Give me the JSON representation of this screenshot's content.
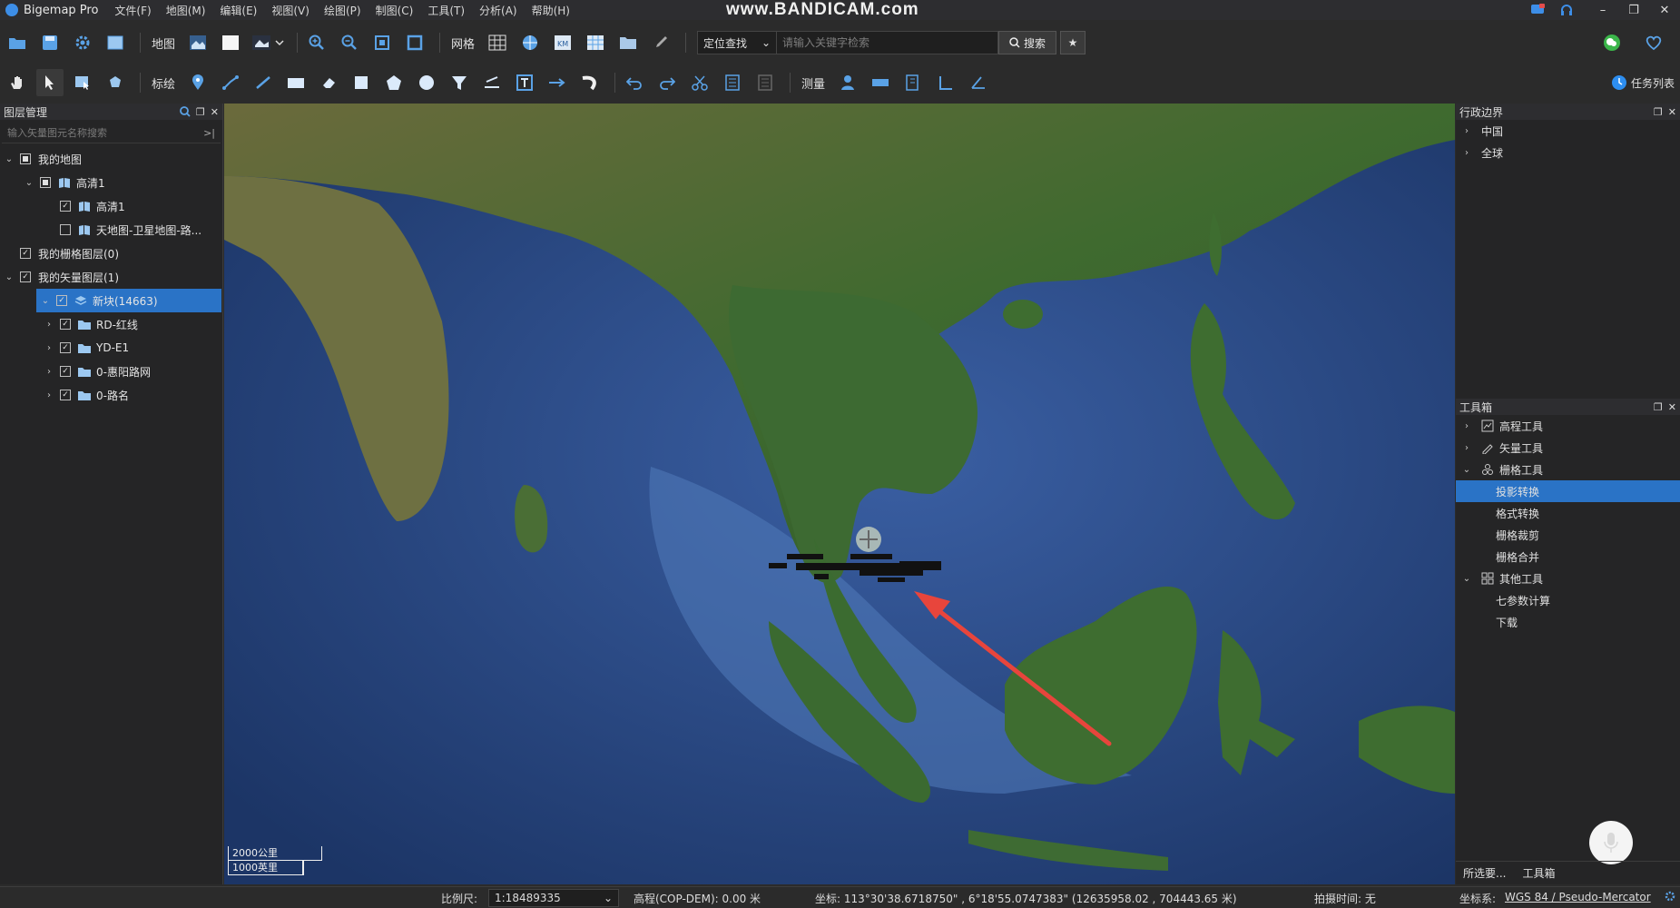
{
  "app": {
    "title": "Bigemap Pro",
    "watermark": "www.BANDICAM.com",
    "menu": [
      "文件(F)",
      "地图(M)",
      "编辑(E)",
      "视图(V)",
      "绘图(P)",
      "制图(C)",
      "工具(T)",
      "分析(A)",
      "帮助(H)"
    ]
  },
  "toolbar1": {
    "map_label": "地图",
    "grid_label": "网格",
    "locate_label": "定位查找",
    "search_placeholder": "请输入关键字检索",
    "search_button": "搜索"
  },
  "toolbar2": {
    "draw_label": "标绘",
    "measure_label": "测量",
    "task_list": "任务列表"
  },
  "layer_panel": {
    "title": "图层管理",
    "search_placeholder": "输入矢量图元名称搜索",
    "tree": [
      {
        "label": "我的地图",
        "level": 0,
        "expanded": true,
        "check": "partial"
      },
      {
        "label": "高清1",
        "level": 1,
        "expanded": true,
        "check": "partial"
      },
      {
        "label": "高清1",
        "level": 2,
        "check": "checked"
      },
      {
        "label": "天地图-卫星地图-路...",
        "level": 2,
        "check": "unchecked"
      },
      {
        "label": "我的栅格图层(0)",
        "level": 0,
        "check": "checked"
      },
      {
        "label": "我的矢量图层(1)",
        "level": 0,
        "expanded": true,
        "check": "checked"
      },
      {
        "label": "新块(14663)",
        "level": 1,
        "expanded": true,
        "check": "checked",
        "selected": true
      },
      {
        "label": "RD-红线",
        "level": 2,
        "expanded": false,
        "check": "checked"
      },
      {
        "label": "YD-E1",
        "level": 2,
        "expanded": false,
        "check": "checked"
      },
      {
        "label": "0-惠阳路网",
        "level": 2,
        "expanded": false,
        "check": "checked"
      },
      {
        "label": "0-路名",
        "level": 2,
        "expanded": false,
        "check": "checked"
      }
    ]
  },
  "map": {
    "scale_km": "2000公里",
    "scale_mi": "1000英里",
    "colors": {
      "ocean": "#2d4f8c",
      "land": "#3f6b34",
      "arrow": "#e8453c"
    }
  },
  "admin_panel": {
    "title": "行政边界",
    "items": [
      "中国",
      "全球"
    ]
  },
  "toolbox": {
    "title": "工具箱",
    "groups": [
      {
        "label": "高程工具",
        "icon": "elevation-icon",
        "expanded": false,
        "items": []
      },
      {
        "label": "矢量工具",
        "icon": "pen-icon",
        "expanded": false,
        "items": []
      },
      {
        "label": "栅格工具",
        "icon": "raster-icon",
        "expanded": true,
        "items": [
          "投影转换",
          "格式转换",
          "栅格裁剪",
          "栅格合并"
        ]
      },
      {
        "label": "其他工具",
        "icon": "grid-apps-icon",
        "expanded": true,
        "items": [
          "七参数计算",
          "下载"
        ]
      }
    ],
    "selected_item": "投影转换",
    "tabs": [
      "所选要...",
      "工具箱"
    ]
  },
  "status": {
    "scale_label": "比例尺:",
    "scale_value": "1:18489335",
    "elevation": "高程(COP-DEM): 0.00 米",
    "coords": "坐标: 113°30'38.6718750\" , 6°18'55.0747383\"  (12635958.02 , 704443.65 米)",
    "capture_time": "拍摄时间: 无",
    "crs_label": "坐标系:",
    "crs_value": "WGS 84 / Pseudo-Mercator"
  }
}
